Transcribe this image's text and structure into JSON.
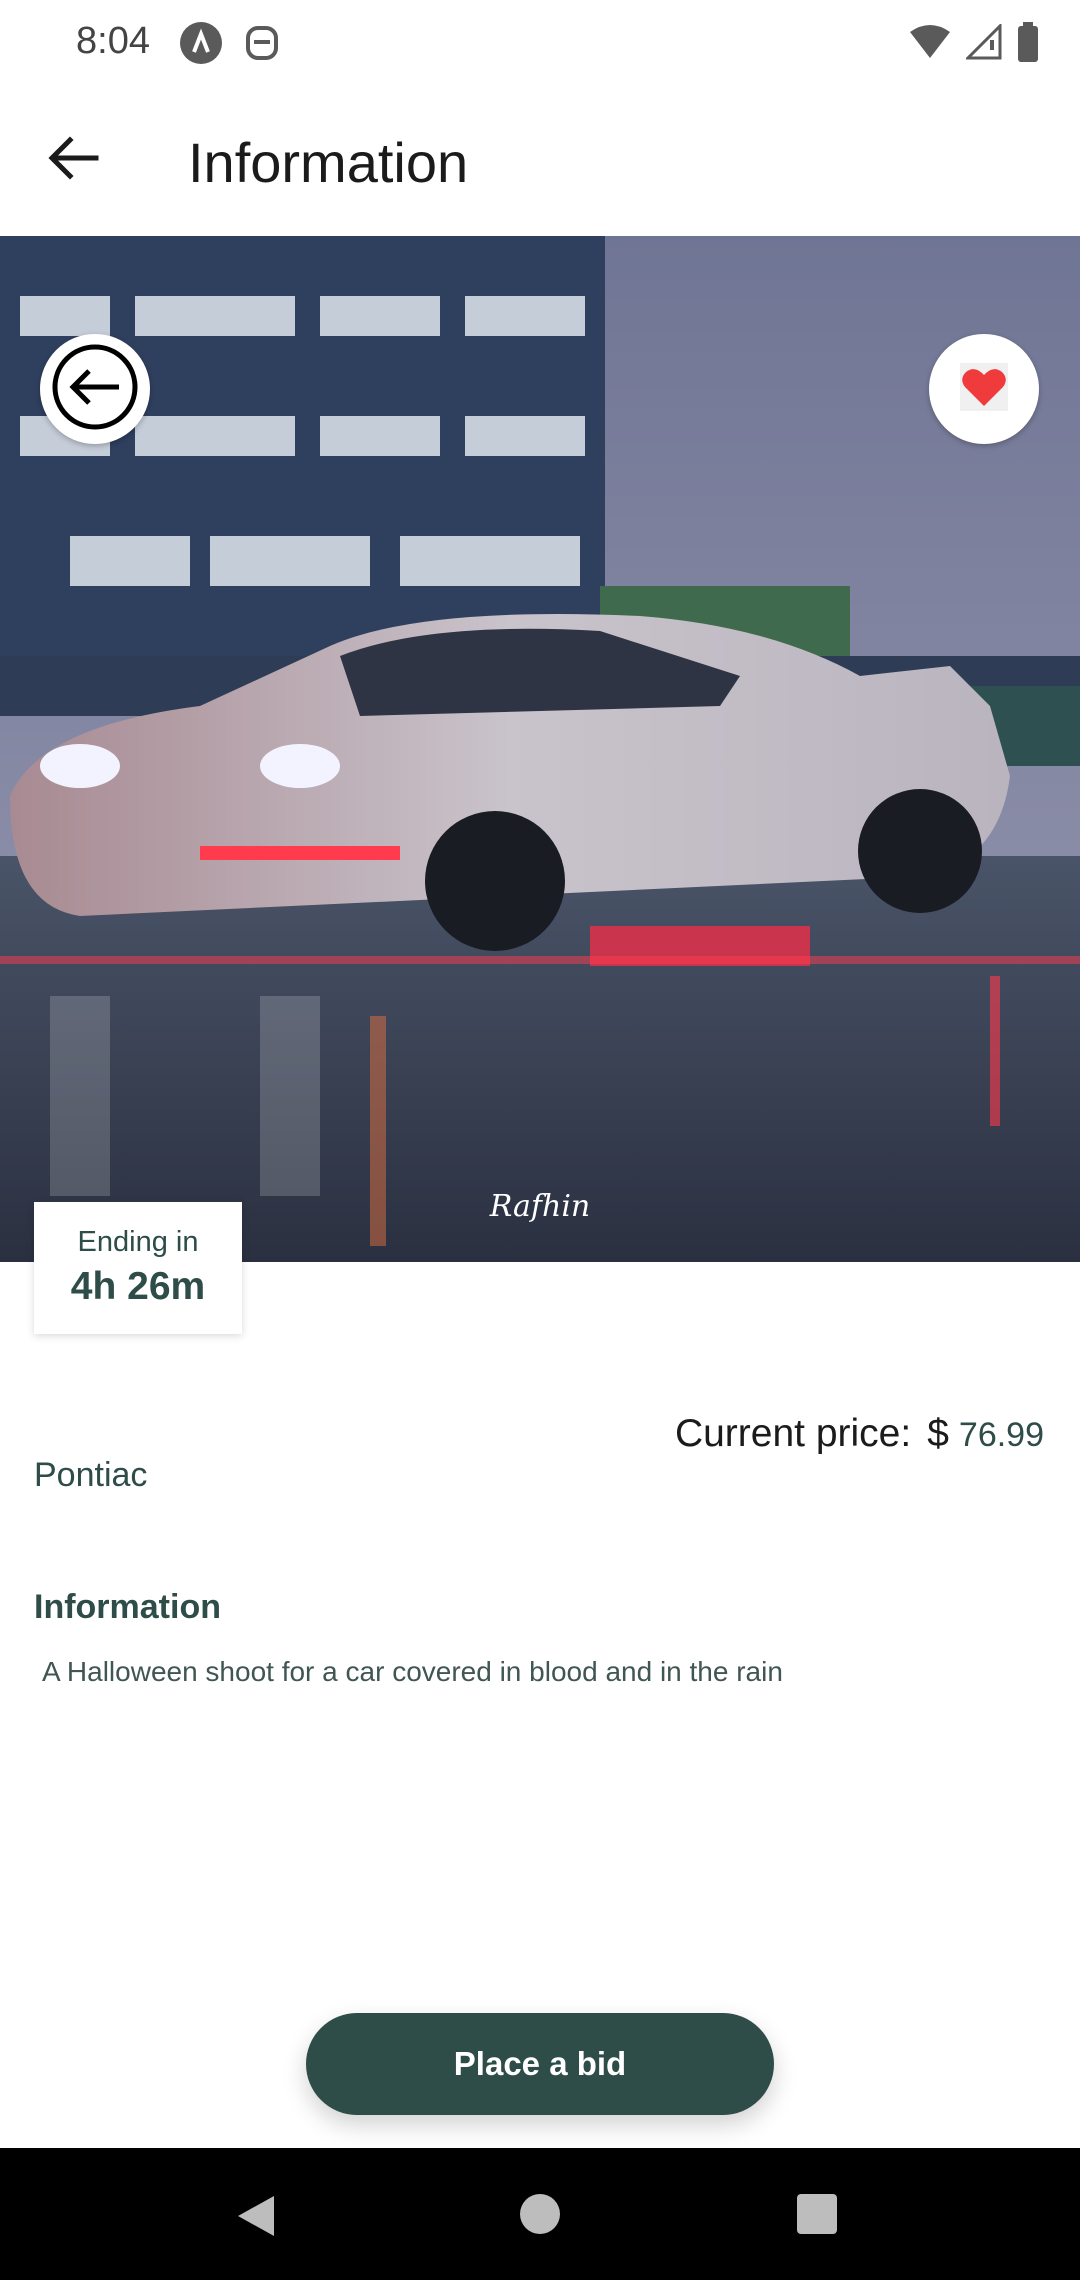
{
  "status_bar": {
    "time": "8:04",
    "left_icons": [
      "a-icon",
      "notification-icon"
    ],
    "right_icons": [
      "wifi-icon",
      "signal-icon",
      "battery-icon"
    ]
  },
  "app_bar": {
    "title": "Information",
    "back_icon": "arrow-left-icon"
  },
  "hero": {
    "description": "photo",
    "back_button_icon": "circle-arrow-left-icon",
    "favorite_icon": "heart-icon",
    "favorite_color": "#ef3b3b",
    "watermark": "Rafhin"
  },
  "auction": {
    "ending_label": "Ending in",
    "ending_value": "4h 26m"
  },
  "price": {
    "label": "Current price:",
    "currency": "$",
    "value": "76.99"
  },
  "car": {
    "name": "Pontiac"
  },
  "information": {
    "heading": "Information",
    "description": "A Halloween shoot for a car covered in blood and in the rain"
  },
  "actions": {
    "bid_label": "Place a bid"
  },
  "colors": {
    "accent": "#2e4c48",
    "background": "#ffffff",
    "nav_bar": "#000000"
  },
  "nav_bar": {
    "buttons": [
      "nav-back-icon",
      "nav-home-icon",
      "nav-recent-icon"
    ]
  }
}
